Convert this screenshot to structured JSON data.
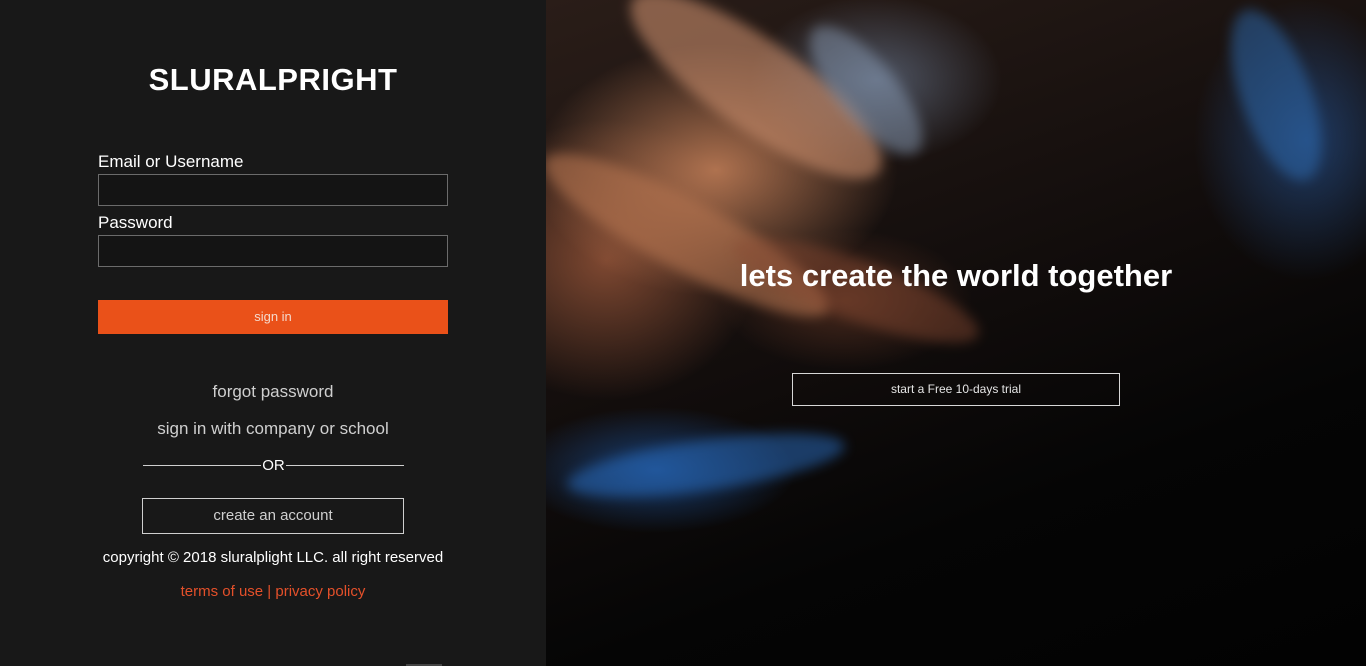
{
  "brand": {
    "name": "SLURALPRIGHT"
  },
  "login": {
    "email_label": "Email or Username",
    "email_value": "",
    "password_label": "Password",
    "password_value": "",
    "signin_label": "sign in",
    "forgot_label": "forgot password",
    "sso_label": "sign in with company or school",
    "or_label": "OR",
    "create_label": "create an account"
  },
  "footer": {
    "copyright": "copyright © 2018 sluralplight LLC. all right reserved",
    "terms_label": "terms of use",
    "separator": " | ",
    "privacy_label": "privacy policy"
  },
  "hero": {
    "tagline": "lets create the world together",
    "trial_label": "start a Free 10-days trial"
  },
  "colors": {
    "accent": "#ea5119",
    "panel_bg": "#181818",
    "link": "#e4502a"
  }
}
